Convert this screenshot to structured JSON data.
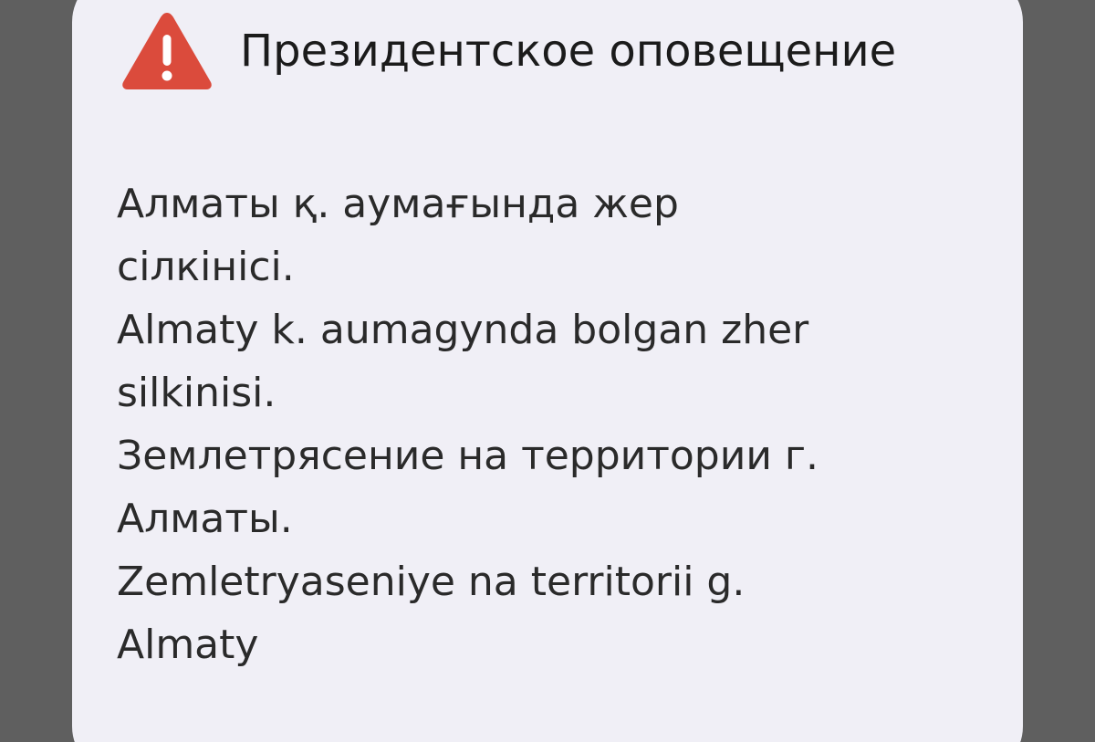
{
  "alert": {
    "icon": "warning-triangle-icon",
    "icon_color": "#db4b3c",
    "title": "Президентское оповещение",
    "lines": [
      "Алматы қ. аумағында жер",
      "сілкінісі.",
      "Almaty k. aumagynda bolgan zher",
      "silkinisi.",
      "Землетрясение на территории г.",
      "Алматы.",
      "Zemletryaseniye na territorii g.",
      "Almaty"
    ]
  },
  "colors": {
    "background": "#5f5f5f",
    "card": "#f0eff6",
    "text": "#1b1b1b"
  }
}
